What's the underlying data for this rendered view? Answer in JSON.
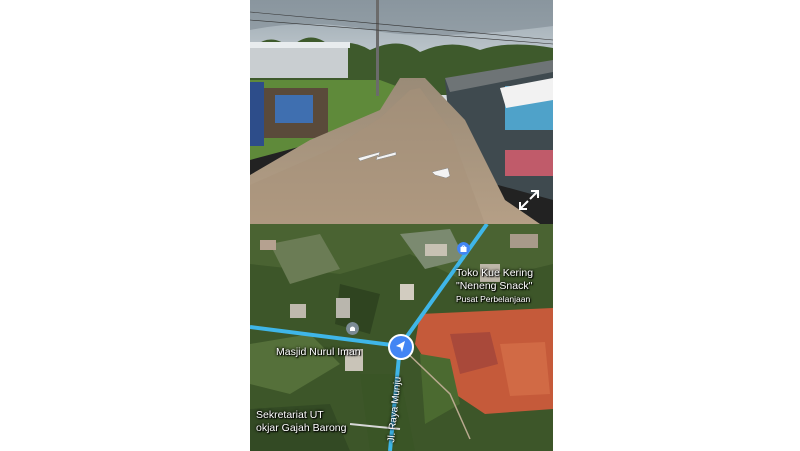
{
  "street_view": {
    "expand_icon": "expand-arrows-icon",
    "nav_arrow_icon": "navigation-arrow-icon"
  },
  "map": {
    "places": [
      {
        "name": "Toko Kue Kering",
        "name2": "\"Neneng Snack\"",
        "category": "Pusat Perbelanjaan",
        "icon": "shopping-bag-icon"
      },
      {
        "name": "Masjid Nurul Iman",
        "icon": "mosque-icon"
      },
      {
        "name": "Sekretariat UT",
        "name2": "okjar Gajah Barong"
      }
    ],
    "road": "Jl. Raya Munju",
    "location_marker_icon": "location-arrow-icon",
    "colors": {
      "road": "#3fb6e8",
      "marker": "#4285f4",
      "soil": "#c55a3a"
    }
  }
}
